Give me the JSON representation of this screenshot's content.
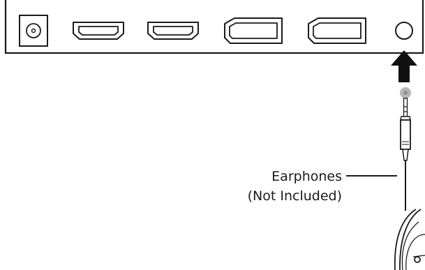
{
  "callout": {
    "line1": "Earphones",
    "line2": "(Not Included)"
  },
  "ports": [
    {
      "id": "dc-in",
      "icon": "dc-power-jack-icon"
    },
    {
      "id": "hdmi-1",
      "icon": "hdmi-port-icon"
    },
    {
      "id": "hdmi-2",
      "icon": "hdmi-port-icon"
    },
    {
      "id": "displayport-1",
      "icon": "displayport-icon"
    },
    {
      "id": "displayport-2",
      "icon": "displayport-icon"
    },
    {
      "id": "audio-out",
      "icon": "audio-jack-icon"
    }
  ],
  "colors": {
    "stroke": "#1a1a1a",
    "plug_tip": "#b5b5b5",
    "background": "#ffffff"
  }
}
